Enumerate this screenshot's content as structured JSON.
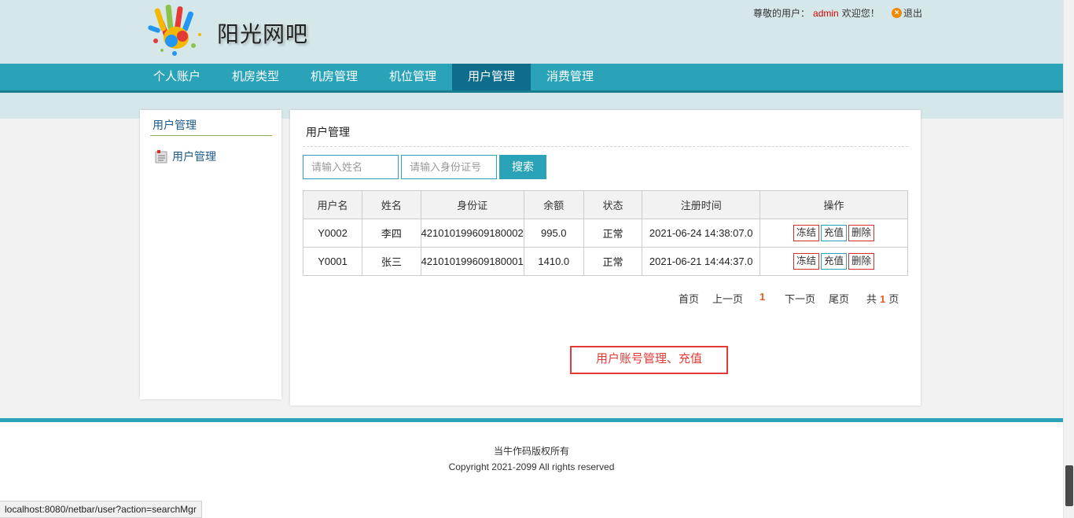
{
  "header": {
    "site_name": "阳光网吧",
    "welcome_prefix": "尊敬的用户：",
    "username": "admin",
    "welcome_suffix": "欢迎您！",
    "logout": "退出"
  },
  "nav": {
    "items": [
      {
        "label": "个人账户"
      },
      {
        "label": "机房类型"
      },
      {
        "label": "机房管理"
      },
      {
        "label": "机位管理"
      },
      {
        "label": "用户管理"
      },
      {
        "label": "消费管理"
      }
    ],
    "active": "用户管理"
  },
  "sidebar": {
    "title": "用户管理",
    "items": [
      {
        "label": "用户管理"
      }
    ]
  },
  "content": {
    "title": "用户管理",
    "search": {
      "name_placeholder": "请输入姓名",
      "id_placeholder": "请输入身份证号",
      "button": "搜索"
    },
    "table": {
      "headers": [
        "用户名",
        "姓名",
        "身份证",
        "余额",
        "状态",
        "注册时间",
        "操作"
      ],
      "rows": [
        {
          "username": "Y0002",
          "name": "李四",
          "id_card": "421010199609180002",
          "balance": "995.0",
          "status": "正常",
          "reg_time": "2021-06-24 14:38:07.0"
        },
        {
          "username": "Y0001",
          "name": "张三",
          "id_card": "421010199609180001",
          "balance": "1410.0",
          "status": "正常",
          "reg_time": "2021-06-21 14:44:37.0"
        }
      ],
      "actions": {
        "freeze": "冻结",
        "recharge": "充值",
        "delete": "删除"
      }
    },
    "pager": {
      "first": "首页",
      "prev": "上一页",
      "current": "1",
      "next": "下一页",
      "last": "尾页",
      "total_prefix": "共",
      "total": "1",
      "total_suffix": "页"
    },
    "annotation": "用户账号管理、充值"
  },
  "footer": {
    "line1": "当牛作码版权所有",
    "line2": "Copyright 2021-2099 All rights reserved"
  },
  "status_url": "localhost:8080/netbar/user?action=searchMgr",
  "colors": {
    "accent": "#2aa3b8",
    "nav_active": "#0e6d8c",
    "header_bg": "#d6e7ea",
    "highlight": "#e85d1f",
    "danger": "#e53935"
  }
}
